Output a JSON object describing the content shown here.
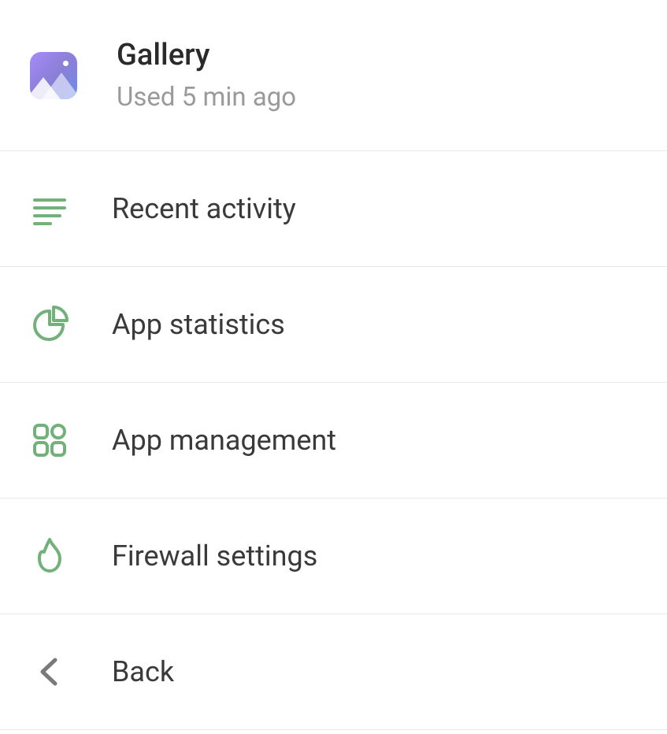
{
  "header": {
    "app_name": "Gallery",
    "subtitle": "Used 5 min ago",
    "icon": "gallery-app-icon"
  },
  "menu": [
    {
      "id": "recent-activity",
      "label": "Recent activity",
      "icon": "lines-icon"
    },
    {
      "id": "app-statistics",
      "label": "App statistics",
      "icon": "pie-chart-icon"
    },
    {
      "id": "app-management",
      "label": "App management",
      "icon": "grid-icon"
    },
    {
      "id": "firewall-settings",
      "label": "Firewall settings",
      "icon": "flame-icon"
    },
    {
      "id": "back",
      "label": "Back",
      "icon": "chevron-left-icon"
    }
  ],
  "colors": {
    "icon_green": "#72b27a",
    "icon_gray": "#7a7a7a",
    "text_primary": "#2a2a2a",
    "text_secondary": "#9a9a9a",
    "divider": "#e8e8e8"
  }
}
